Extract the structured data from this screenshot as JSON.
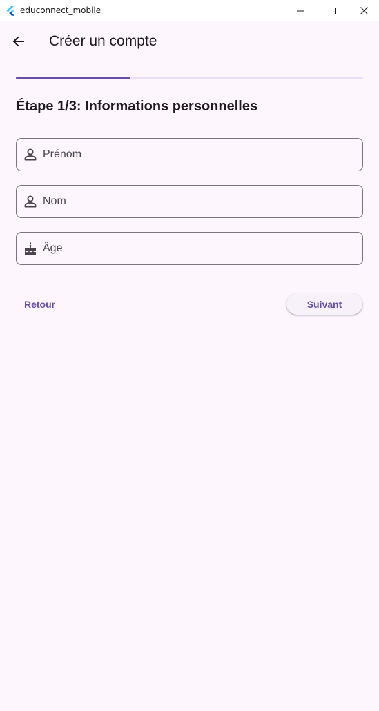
{
  "window": {
    "title": "educonnect_mobile",
    "logo_icon": "flutter-logo-icon",
    "controls": [
      "minimize-icon",
      "maximize-icon",
      "close-icon"
    ]
  },
  "appbar": {
    "back_icon": "arrow-back-icon",
    "title": "Créer un compte"
  },
  "progress": {
    "current_step": 1,
    "total_steps": 3,
    "fraction": 0.33
  },
  "step": {
    "heading": "Étape 1/3: Informations personnelles"
  },
  "form": {
    "fields": [
      {
        "name": "prenom",
        "icon": "person-icon",
        "placeholder": "Prénom",
        "value": ""
      },
      {
        "name": "nom",
        "icon": "person-icon",
        "placeholder": "Nom",
        "value": ""
      },
      {
        "name": "age",
        "icon": "cake-icon",
        "placeholder": "Âge",
        "value": ""
      }
    ]
  },
  "actions": {
    "back_label": "Retour",
    "next_label": "Suivant"
  },
  "colors": {
    "primary": "#6750a4",
    "track": "#e8def8",
    "background": "#fdf7fd",
    "outline": "#79747e"
  }
}
